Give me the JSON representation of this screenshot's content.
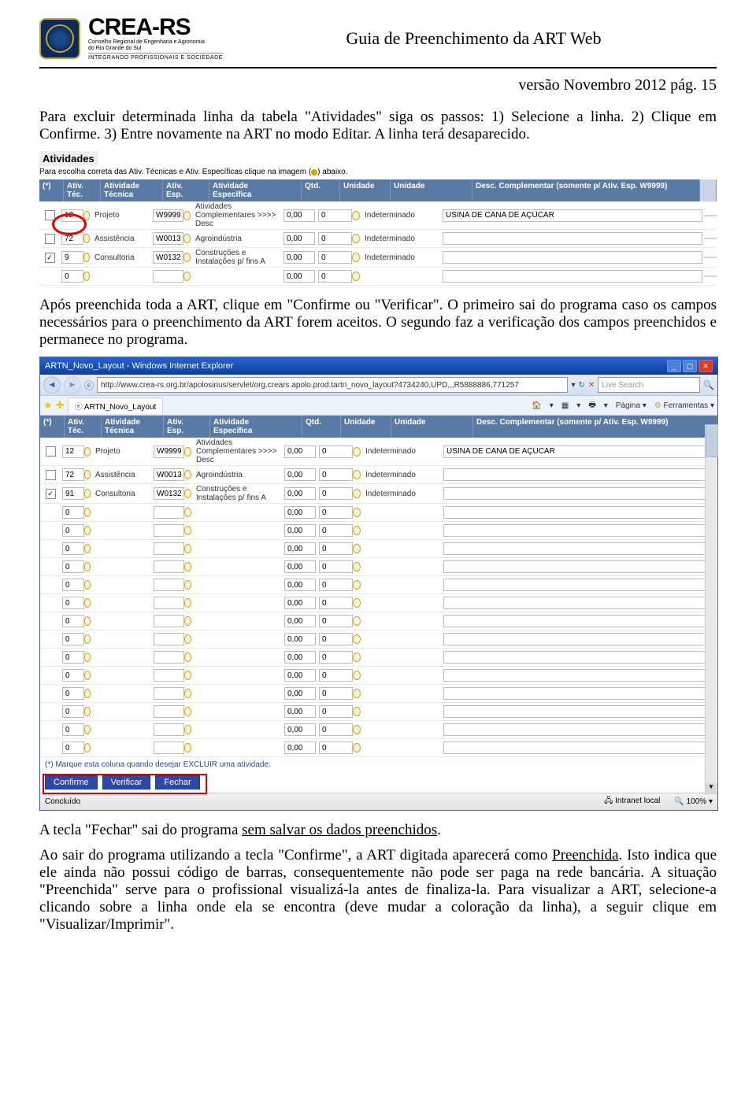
{
  "header": {
    "logo_main": "CREA-RS",
    "logo_sub1": "Conselho Regional de Engenharia e Agronomia",
    "logo_sub2": "do Rio Grande do Sul",
    "logo_sub3": "INTEGRANDO PROFISSIONAIS E SOCIEDADE",
    "title": "Guia de Preenchimento da ART Web"
  },
  "version_line": "versão Novembro 2012       pág. 15",
  "para1": "Para excluir determinada linha da tabela \"Atividades\" siga os passos: 1) Selecione a linha. 2) Clique em Confirme. 3) Entre novamente na ART no modo Editar. A linha terá desaparecido.",
  "para2": "Após preenchida toda a ART, clique em \"Confirme ou \"Verificar\". O primeiro sai do programa caso os campos necessários para o preenchimento da ART forem aceitos. O segundo faz a verificação dos campos preenchidos e permanece no programa.",
  "para3": "A tecla \"Fechar\" sai do programa sem salvar os dados preenchidos.",
  "para4": "Ao sair do programa utilizando a tecla \"Confirme\", a ART digitada aparecerá como Preenchida. Isto indica que ele ainda não possui código de barras, consequentemente não pode ser paga na rede bancária. A situação \"Preenchida\" serve para o profissional visualizá-la antes de finaliza-la. Para visualizar a ART, selecione-a clicando sobre a linha onde ela se encontra (deve mudar a coloração da linha), a seguir clique em \"Visualizar/Imprimir\".",
  "ss1": {
    "title": "Atividades",
    "note_prefix": "Para escolha correta das Ativ. Técnicas e Ativ. Específicas clique na imagem (",
    "note_suffix": ") abaixo.",
    "headers": {
      "chk": "(*)",
      "ativtec": "Ativ.\nTéc.",
      "tecnica": "Atividade\nTécnica",
      "esp": "Ativ.\nEsp.",
      "especifica": "Atividade\nEspecífica",
      "qtd": "Qtd.",
      "unidade1": "Unidade",
      "unidade2": "Unidade",
      "desc": "Desc. Complementar (somente p/ Ativ. Esp. W9999)"
    },
    "rows": [
      {
        "chk": false,
        "ativtec": "12",
        "tecnica": "Projeto",
        "esp": "W9999",
        "especifica": "Atividades Complementares >>>> Desc",
        "qtd": "0,00",
        "uni1": "0",
        "uni2": "Indeterminado",
        "desc": "USINA DE CANA DE AÇÚCAR"
      },
      {
        "chk": false,
        "ativtec": "72",
        "tecnica": "Assistência",
        "esp": "W0013",
        "especifica": "Agroindústria",
        "qtd": "0,00",
        "uni1": "0",
        "uni2": "Indeterminado",
        "desc": ""
      },
      {
        "chk": true,
        "ativtec": "9",
        "tecnica": "Consultoria",
        "esp": "W0132",
        "especifica": "Construções e Instalações p/ fins A",
        "qtd": "0,00",
        "uni1": "0",
        "uni2": "Indeterminado",
        "desc": ""
      },
      {
        "chk": null,
        "ativtec": "0",
        "tecnica": "",
        "esp": "",
        "especifica": "",
        "qtd": "0,00",
        "uni1": "0",
        "uni2": "",
        "desc": ""
      }
    ]
  },
  "ss2": {
    "window_title": "ARTN_Novo_Layout - Windows Internet Explorer",
    "url": "http://www.crea-rs.org.br/apolosirius/servlet/org.crears.apolo.prod.tartn_novo_layout?4734240,UPD,,,R5888886,771257",
    "url_dropdown_icon": "▾",
    "refresh_icon": "↻",
    "stop_icon": "✕",
    "live_search": "Live Search",
    "search_btn": "🔍",
    "tab_label": "ARTN_Novo_Layout",
    "tools": {
      "home": "🏠",
      "rss": "▦",
      "print": "🖶",
      "pagina": "Página",
      "ferramentas": "Ferramentas"
    },
    "headers": {
      "chk": "(*)",
      "ativtec": "Ativ.\nTéc.",
      "tecnica": "Atividade\nTécnica",
      "esp": "Ativ.\nEsp.",
      "especifica": "Atividade\nEspecífica",
      "qtd": "Qtd.",
      "unidade1": "Unidade",
      "unidade2": "Unidade",
      "desc": "Desc. Complementar (somente p/ Ativ. Esp. W9999)"
    },
    "rows": [
      {
        "chk": false,
        "ativtec": "12",
        "tecnica": "Projeto",
        "esp": "W9999",
        "especifica": "Atividades Complementares >>>> Desc",
        "qtd": "0,00",
        "uni1": "0",
        "uni2": "Indeterminado",
        "desc": "USINA DE CANA DE AÇÚCAR"
      },
      {
        "chk": false,
        "ativtec": "72",
        "tecnica": "Assistência",
        "esp": "W0013",
        "especifica": "Agroindústria",
        "qtd": "0,00",
        "uni1": "0",
        "uni2": "Indeterminado",
        "desc": ""
      },
      {
        "chk": true,
        "ativtec": "91",
        "tecnica": "Consultoria",
        "esp": "W0132",
        "especifica": "Construções e Instalações p/ fins A",
        "qtd": "0,00",
        "uni1": "0",
        "uni2": "Indeterminado",
        "desc": ""
      },
      {
        "chk": null,
        "ativtec": "0",
        "tecnica": "",
        "esp": "",
        "especifica": "",
        "qtd": "0,00",
        "uni1": "0",
        "uni2": "",
        "desc": ""
      },
      {
        "chk": null,
        "ativtec": "0",
        "tecnica": "",
        "esp": "",
        "especifica": "",
        "qtd": "0,00",
        "uni1": "0",
        "uni2": "",
        "desc": ""
      },
      {
        "chk": null,
        "ativtec": "0",
        "tecnica": "",
        "esp": "",
        "especifica": "",
        "qtd": "0,00",
        "uni1": "0",
        "uni2": "",
        "desc": ""
      },
      {
        "chk": null,
        "ativtec": "0",
        "tecnica": "",
        "esp": "",
        "especifica": "",
        "qtd": "0,00",
        "uni1": "0",
        "uni2": "",
        "desc": ""
      },
      {
        "chk": null,
        "ativtec": "0",
        "tecnica": "",
        "esp": "",
        "especifica": "",
        "qtd": "0,00",
        "uni1": "0",
        "uni2": "",
        "desc": ""
      },
      {
        "chk": null,
        "ativtec": "0",
        "tecnica": "",
        "esp": "",
        "especifica": "",
        "qtd": "0,00",
        "uni1": "0",
        "uni2": "",
        "desc": ""
      },
      {
        "chk": null,
        "ativtec": "0",
        "tecnica": "",
        "esp": "",
        "especifica": "",
        "qtd": "0,00",
        "uni1": "0",
        "uni2": "",
        "desc": ""
      },
      {
        "chk": null,
        "ativtec": "0",
        "tecnica": "",
        "esp": "",
        "especifica": "",
        "qtd": "0,00",
        "uni1": "0",
        "uni2": "",
        "desc": ""
      },
      {
        "chk": null,
        "ativtec": "0",
        "tecnica": "",
        "esp": "",
        "especifica": "",
        "qtd": "0,00",
        "uni1": "0",
        "uni2": "",
        "desc": ""
      },
      {
        "chk": null,
        "ativtec": "0",
        "tecnica": "",
        "esp": "",
        "especifica": "",
        "qtd": "0,00",
        "uni1": "0",
        "uni2": "",
        "desc": ""
      },
      {
        "chk": null,
        "ativtec": "0",
        "tecnica": "",
        "esp": "",
        "especifica": "",
        "qtd": "0,00",
        "uni1": "0",
        "uni2": "",
        "desc": ""
      },
      {
        "chk": null,
        "ativtec": "0",
        "tecnica": "",
        "esp": "",
        "especifica": "",
        "qtd": "0,00",
        "uni1": "0",
        "uni2": "",
        "desc": ""
      },
      {
        "chk": null,
        "ativtec": "0",
        "tecnica": "",
        "esp": "",
        "especifica": "",
        "qtd": "0,00",
        "uni1": "0",
        "uni2": "",
        "desc": ""
      },
      {
        "chk": null,
        "ativtec": "0",
        "tecnica": "",
        "esp": "",
        "especifica": "",
        "qtd": "0,00",
        "uni1": "0",
        "uni2": "",
        "desc": ""
      }
    ],
    "excluir_note": "(*) Marque esta coluna quando desejar EXCLUIR uma atividade.",
    "buttons": {
      "confirme": "Confirme",
      "verificar": "Verificar",
      "fechar": "Fechar"
    },
    "status_left": "Concluído",
    "status_intranet": "Intranet local",
    "status_zoom": "100%"
  }
}
